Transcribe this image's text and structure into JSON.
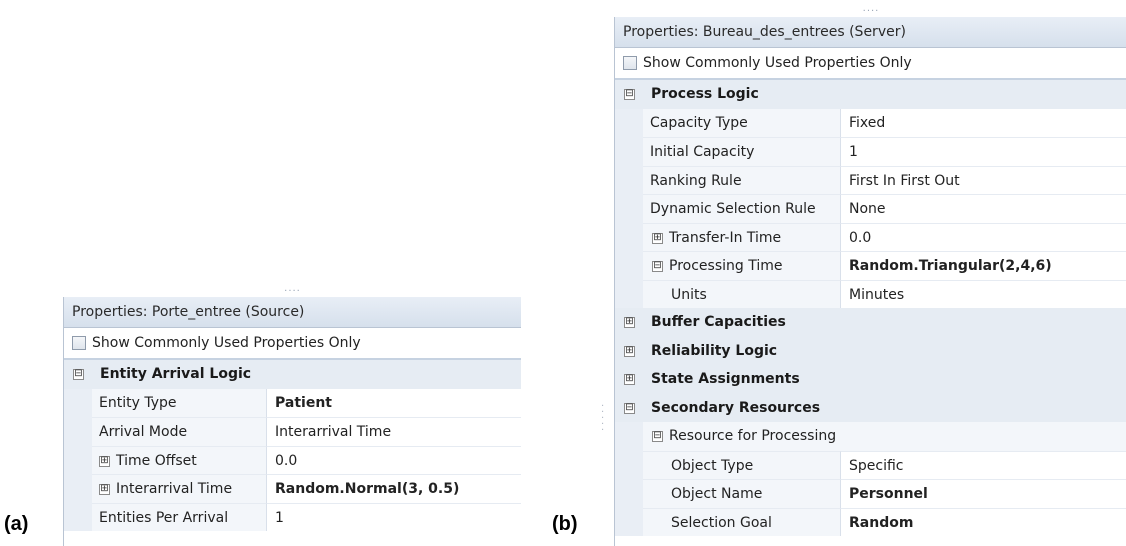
{
  "panel_a": {
    "label": "(a)",
    "grip": "....",
    "title": "Properties: Porte_entree (Source)",
    "show_common_label": "Show Commonly Used Properties Only",
    "category": {
      "toggle": "⊟",
      "label": "Entity Arrival Logic"
    },
    "rows": [
      {
        "name": "Entity Type",
        "value": "Patient"
      },
      {
        "name": "Arrival Mode",
        "value": "Interarrival Time"
      },
      {
        "toggle": "⊞",
        "name": "Time Offset",
        "value": "0.0"
      },
      {
        "toggle": "⊞",
        "name": "Interarrival Time",
        "value": "Random.Normal(3, 0.5)"
      },
      {
        "name": "Entities Per Arrival",
        "value": "1"
      }
    ]
  },
  "panel_b": {
    "label": "(b)",
    "grip": "....",
    "title": "Properties: Bureau_des_entrees (Server)",
    "show_common_label": "Show Commonly Used Properties Only",
    "process_logic": {
      "toggle": "⊟",
      "label": "Process Logic"
    },
    "process_rows": [
      {
        "name": "Capacity Type",
        "value": "Fixed"
      },
      {
        "name": "Initial Capacity",
        "value": "1"
      },
      {
        "name": "Ranking Rule",
        "value": "First In First Out"
      },
      {
        "name": "Dynamic Selection Rule",
        "value": "None"
      },
      {
        "toggle": "⊞",
        "name": "Transfer-In Time",
        "value": "0.0"
      },
      {
        "toggle": "⊟",
        "name": "Processing Time",
        "value": "Random.Triangular(2,4,6)"
      },
      {
        "name": "Units",
        "value": "Minutes"
      }
    ],
    "categories": [
      {
        "toggle": "⊞",
        "label": "Buffer Capacities"
      },
      {
        "toggle": "⊞",
        "label": "Reliability Logic"
      },
      {
        "toggle": "⊞",
        "label": "State Assignments"
      },
      {
        "toggle": "⊟",
        "label": "Secondary Resources"
      }
    ],
    "sub_group": {
      "toggle": "⊟",
      "label": "Resource for Processing"
    },
    "sub_rows": [
      {
        "name": "Object Type",
        "value": "Specific"
      },
      {
        "name": "Object Name",
        "value": "Personnel"
      },
      {
        "name": "Selection Goal",
        "value": "Random"
      }
    ]
  }
}
